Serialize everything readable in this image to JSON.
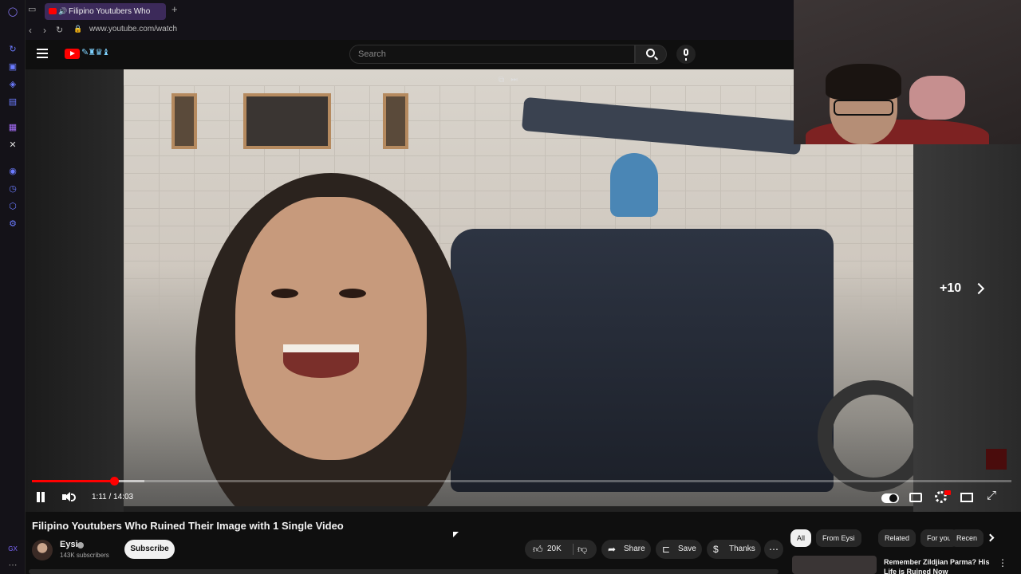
{
  "browser": {
    "tab_title": "Filipino Youtubers Who",
    "url": "www.youtube.com/watch"
  },
  "masthead": {
    "search_placeholder": "Search"
  },
  "player": {
    "current_time": "1:11",
    "duration": "14:03",
    "time_display": "1:11 / 14:03",
    "played_fraction": 0.084,
    "buffered_fraction": 0.115,
    "skip_label": "+10"
  },
  "video": {
    "title": "Filipino Youtubers Who Ruined Their Image with 1 Single Video",
    "channel": "Eysi",
    "subscribers": "143K subscribers",
    "subscribe_label": "Subscribe",
    "like_count": "20K",
    "share_label": "Share",
    "save_label": "Save",
    "thanks_label": "Thanks"
  },
  "chips": [
    {
      "label": "All",
      "active": true
    },
    {
      "label": "From Eysi",
      "active": false
    },
    {
      "label": "Related",
      "active": false
    },
    {
      "label": "For you",
      "active": false
    },
    {
      "label": "Recen",
      "active": false
    }
  ],
  "recommendation": {
    "title": "Remember Zildjian Parma? His Life is Ruined Now"
  },
  "icons": {
    "search": "search-icon",
    "mic": "mic-icon",
    "like": "thumbs-up-icon",
    "dislike": "thumbs-down-icon",
    "share": "share-icon",
    "save": "bookmark-icon",
    "thanks": "thanks-icon"
  },
  "colors": {
    "accent": "#ff0000",
    "background": "#0f0f0f",
    "browser_tab_active": "#3c2a5a"
  }
}
